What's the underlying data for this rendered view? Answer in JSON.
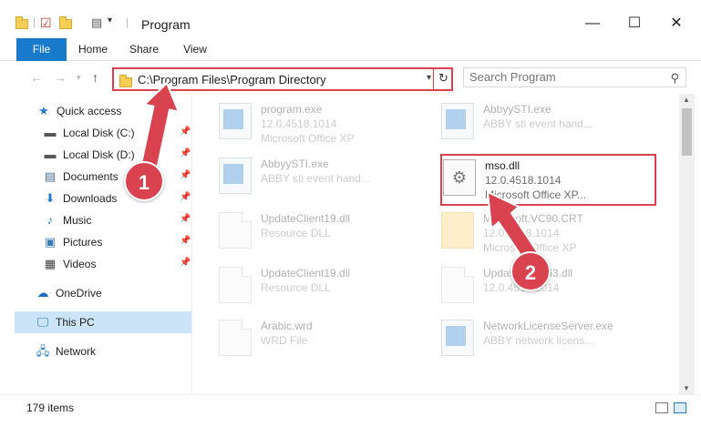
{
  "window": {
    "title": "Program",
    "minimize_glyph": "—",
    "maximize_glyph": "☐",
    "close_glyph": "✕"
  },
  "ribbon": {
    "tabs": [
      "File",
      "Home",
      "Share",
      "View"
    ]
  },
  "address": {
    "path": "C:\\Program Files\\Program Directory",
    "search_placeholder": "Search Program"
  },
  "sidebar": {
    "quick_access": "Quick access",
    "items": [
      {
        "label": "Local Disk (C:)",
        "icon": "drive-icon",
        "pinned": true
      },
      {
        "label": "Local Disk (D:)",
        "icon": "drive-icon",
        "pinned": true
      },
      {
        "label": "Documents",
        "icon": "documents-icon",
        "pinned": true
      },
      {
        "label": "Downloads",
        "icon": "downloads-icon",
        "pinned": true
      },
      {
        "label": "Music",
        "icon": "music-icon",
        "pinned": true
      },
      {
        "label": "Pictures",
        "icon": "pictures-icon",
        "pinned": true
      },
      {
        "label": "Videos",
        "icon": "videos-icon",
        "pinned": true
      }
    ],
    "onedrive": "OneDrive",
    "this_pc": "This PC",
    "network": "Network"
  },
  "files": [
    {
      "name": "program.exe",
      "line1": "12.0.4518.1014",
      "line2": "Microsoft Office XP",
      "icon": "setup-icon",
      "faded": true
    },
    {
      "name": "AbbyySTI.exe",
      "line1": "ABBY sti event hand...",
      "line2": "",
      "icon": "app-icon",
      "faded": true
    },
    {
      "name": "AbbyySTI.exe",
      "line1": "ABBY sti event hand...",
      "line2": "",
      "icon": "app-icon",
      "faded": true
    },
    {
      "name": "mso.dll",
      "line1": "12.0.4518.1014",
      "line2": "Microsoft Office XP...",
      "icon": "dll-gear-icon",
      "faded": false
    },
    {
      "name": "UpdateClient19.dll",
      "line1": "Resource DLL",
      "line2": "",
      "icon": "dll-icon",
      "faded": true
    },
    {
      "name": "Microsoft.VC90.CRT",
      "line1": "12.0.4518.1014",
      "line2": "Microsoft Office XP",
      "icon": "folder-icon",
      "faded": true
    },
    {
      "name": "UpdateClient19.dll",
      "line1": "Resource DLL",
      "line2": "",
      "icon": "dll-icon",
      "faded": true
    },
    {
      "name": "UpdateClient63.dll",
      "line1": "12.0.4518.1014",
      "line2": "",
      "icon": "dll-icon",
      "faded": true
    },
    {
      "name": "Arabic.wrd",
      "line1": "WRD File",
      "line2": "",
      "icon": "doc-icon",
      "faded": true
    },
    {
      "name": "NetworkLicenseServer.exe",
      "line1": "ABBY network licens...",
      "line2": "",
      "icon": "app-icon",
      "faded": true
    }
  ],
  "status": {
    "item_count": "179 items"
  },
  "annotations": {
    "step1": "1",
    "step2": "2",
    "color": "#d8434f"
  }
}
